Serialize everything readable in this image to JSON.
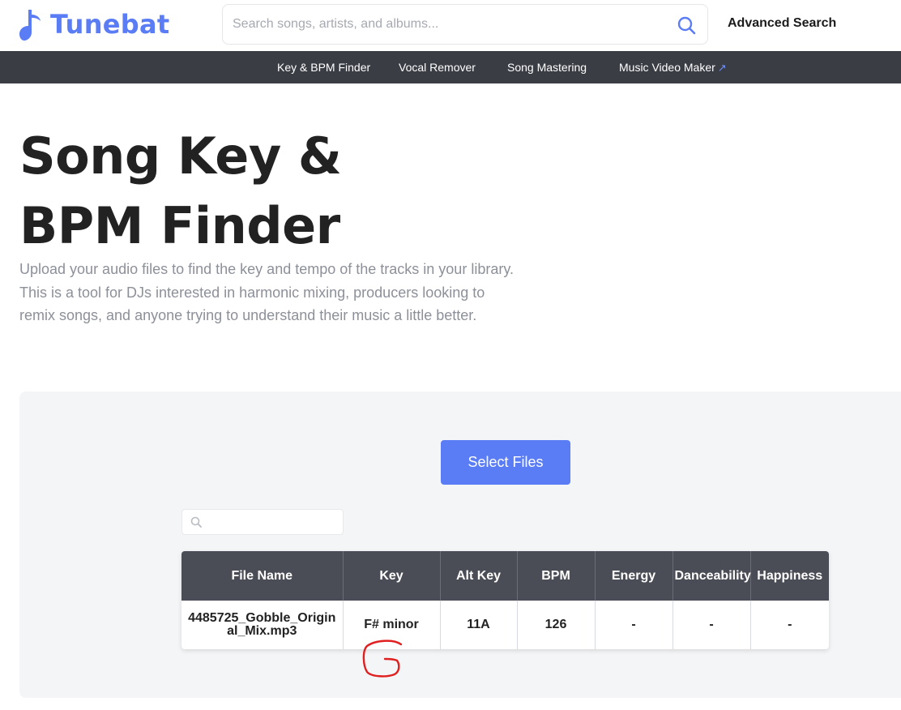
{
  "header": {
    "brand": "Tunebat",
    "search_placeholder": "Search songs, artists, and albums...",
    "advanced_search": "Advanced Search",
    "icons": {
      "logo": "music-note-icon",
      "search": "search-icon"
    }
  },
  "nav": {
    "items": [
      {
        "label": "Key & BPM Finder"
      },
      {
        "label": "Vocal Remover"
      },
      {
        "label": "Song Mastering"
      },
      {
        "label": "Music Video Maker",
        "external": true,
        "icon": "external-arrow-icon"
      }
    ]
  },
  "hero": {
    "title": "Song Key & BPM Finder",
    "description": "Upload your audio files to find the key and tempo of the tracks in your library. This is a tool for DJs interested in harmonic mixing, producers looking to remix songs, and anyone trying to understand their music a little better."
  },
  "upload": {
    "select_files_label": "Select Files",
    "filter_placeholder": "",
    "filter_icon": "search-icon"
  },
  "results": {
    "columns": [
      "File Name",
      "Key",
      "Alt Key",
      "BPM",
      "Energy",
      "Danceability",
      "Happiness"
    ],
    "rows": [
      [
        "4485725_Gobble_Original_Mix.mp3",
        "F# minor",
        "11A",
        "126",
        "-",
        "-",
        "-"
      ]
    ]
  },
  "annotation": {
    "type": "hand-drawn-scribble",
    "color": "#e02020"
  },
  "colors": {
    "brand": "#5a7cf5",
    "nav_bg": "#3a3d44",
    "table_header_bg": "#4a4d55",
    "panel_bg": "#f4f5f7",
    "description_text": "#8c9099"
  }
}
